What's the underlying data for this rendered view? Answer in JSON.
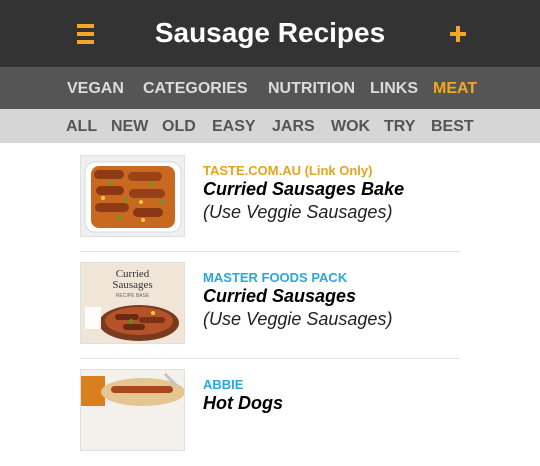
{
  "header": {
    "title": "Sausage Recipes",
    "menu_icon": "menu-icon",
    "add_icon": "plus-icon",
    "accent_color": "#f5a623",
    "bar_color": "#333333"
  },
  "categories": [
    {
      "label": "VEGAN",
      "active": false
    },
    {
      "label": "CATEGORIES",
      "active": false
    },
    {
      "label": "NUTRITION",
      "active": false
    },
    {
      "label": "LINKS",
      "active": false
    },
    {
      "label": "MEAT",
      "active": true
    }
  ],
  "filters": [
    "ALL",
    "NEW",
    "OLD",
    "EASY",
    "JARS",
    "WOK",
    "TRY",
    "BEST"
  ],
  "recipes": [
    {
      "source": "TASTE.COM.AU (Link Only)",
      "source_color": "#e8a31c",
      "name": "Curried Sausages Bake",
      "note": "(Use Veggie Sausages)"
    },
    {
      "source": "MASTER FOODS PACK",
      "source_color": "#29a8dc",
      "name": "Curried Sausages",
      "note": "(Use Veggie Sausages)",
      "pack_text": {
        "line1": "Curried",
        "line2": "Sausages",
        "line3": "RECIPE BASE"
      }
    },
    {
      "source": "ABBIE",
      "source_color": "#29a8dc",
      "name": "Hot Dogs",
      "note": ""
    }
  ]
}
